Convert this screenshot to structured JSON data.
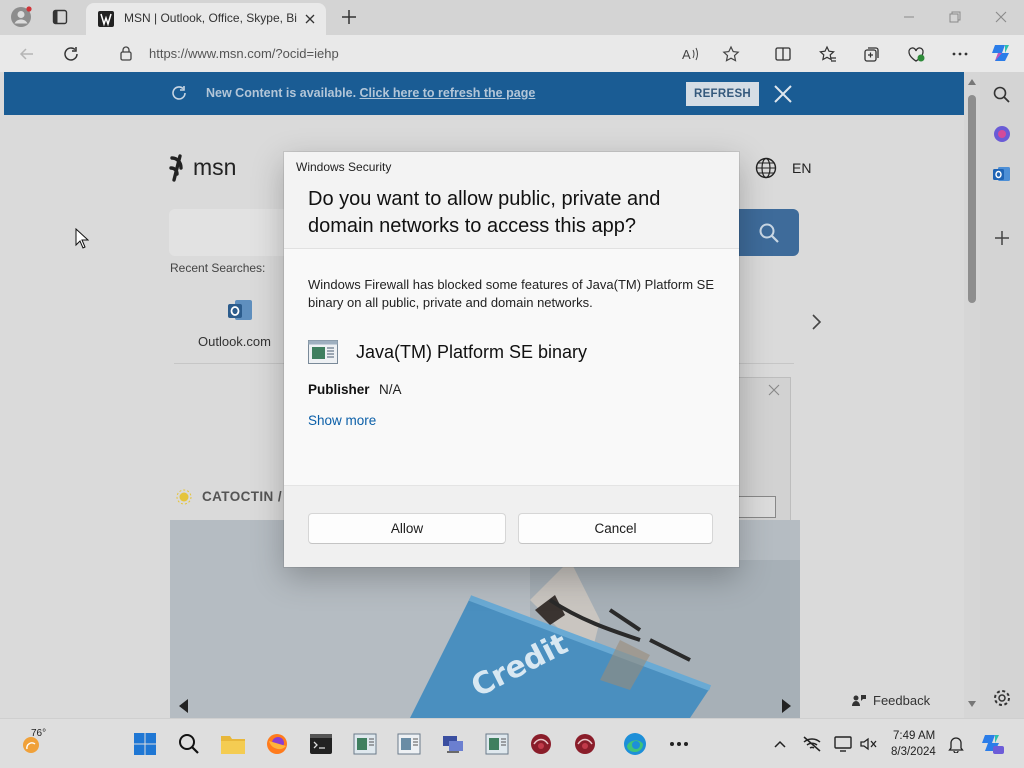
{
  "browser": {
    "tab_title": "MSN | Outlook, Office, Skype, Bi",
    "url": "https://www.msn.com/?ocid=iehp"
  },
  "page": {
    "banner": {
      "message": "New Content is available.",
      "link": "Click here to refresh the page",
      "refresh_label": "REFRESH"
    },
    "logo_text": "msn",
    "language": "EN",
    "recent_searches_label": "Recent Searches:",
    "recent_items": [
      "Outlook.com"
    ],
    "weather_location": "CATOCTIN /",
    "hero_image_text": "Credit",
    "feedback_label": "Feedback"
  },
  "dialog": {
    "caption": "Windows Security",
    "heading": "Do you want to allow public, private and domain networks to access this app?",
    "body": "Windows Firewall has blocked some features of Java(TM) Platform SE binary on all public, private and domain networks.",
    "app_name": "Java(TM) Platform SE binary",
    "publisher_label": "Publisher",
    "publisher_value": "N/A",
    "show_more": "Show more",
    "allow_label": "Allow",
    "cancel_label": "Cancel"
  },
  "taskbar": {
    "temperature": "76°",
    "time": "7:49 AM",
    "date": "8/3/2024"
  },
  "colors": {
    "banner": "#1a5c94",
    "search_button": "#3e6b9a",
    "link": "#0b5fa8",
    "taskbar": "#dedede"
  }
}
